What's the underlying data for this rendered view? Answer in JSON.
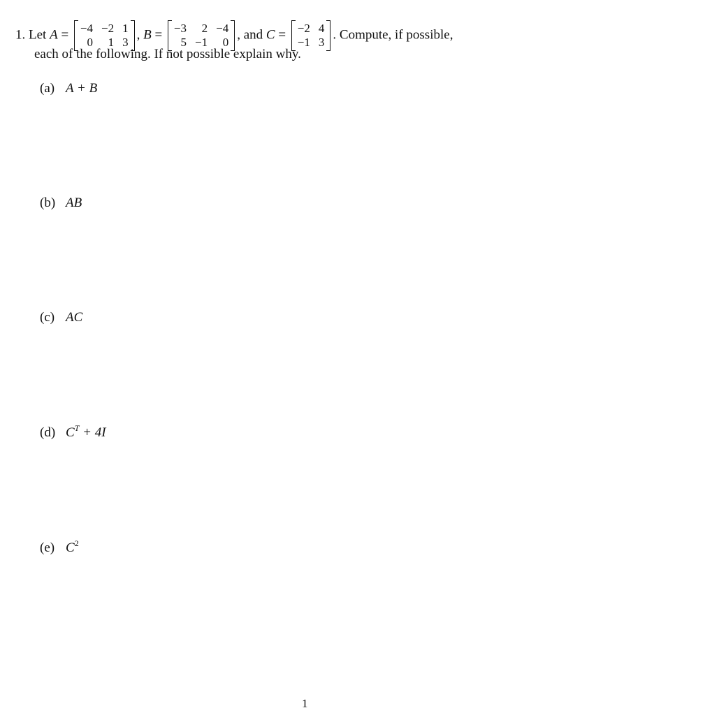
{
  "problem": {
    "number": "1.",
    "intro": "Let",
    "matrices": {
      "A": {
        "name": "A",
        "rows": [
          [
            "−4",
            "−2",
            "1"
          ],
          [
            "0",
            "1",
            "3"
          ]
        ]
      },
      "B": {
        "name": "B",
        "rows": [
          [
            "−3",
            "2",
            "−4"
          ],
          [
            "5",
            "−1",
            "0"
          ]
        ]
      },
      "C": {
        "name": "C",
        "rows": [
          [
            "−2",
            "4"
          ],
          [
            "−1",
            "3"
          ]
        ]
      }
    },
    "equals": "=",
    "comma": ",",
    "and_text": ", and",
    "after_C": ". Compute, if possible,",
    "continuation": "each of the following. If not possible explain why."
  },
  "parts": [
    {
      "label": "(a)",
      "expr_main": "A + B",
      "sup": "",
      "expr_tail": ""
    },
    {
      "label": "(b)",
      "expr_main": "AB",
      "sup": "",
      "expr_tail": ""
    },
    {
      "label": "(c)",
      "expr_main": "AC",
      "sup": "",
      "expr_tail": ""
    },
    {
      "label": "(d)",
      "expr_main": "C",
      "sup": "T",
      "expr_tail": " + 4I"
    },
    {
      "label": "(e)",
      "expr_main": "C",
      "sup": "2",
      "expr_tail": ""
    }
  ],
  "page_number": "1"
}
